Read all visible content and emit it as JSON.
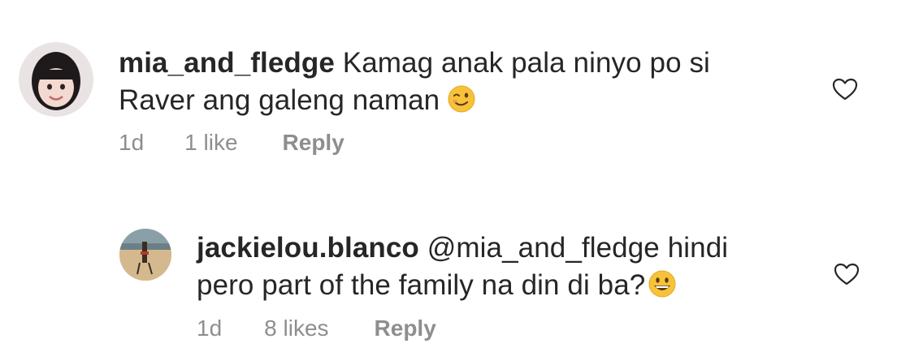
{
  "comments": [
    {
      "username": "mia_and_fledge",
      "line1": "Kamag anak pala ninyo po si",
      "line2": "Raver ang galeng naman",
      "emoji": "winking-face",
      "age": "1d",
      "likes": "1 like",
      "reply": "Reply"
    },
    {
      "username": "jackielou.blanco",
      "mention": "@mia_and_fledge",
      "line1_rest": "hindi",
      "line2": "pero part of the family na din di ba?",
      "emoji": "grinning-face",
      "age": "1d",
      "likes": "8 likes",
      "reply": "Reply"
    }
  ],
  "colors": {
    "text": "#262626",
    "meta": "#8e8e8e",
    "heart_outline": "#262626"
  }
}
